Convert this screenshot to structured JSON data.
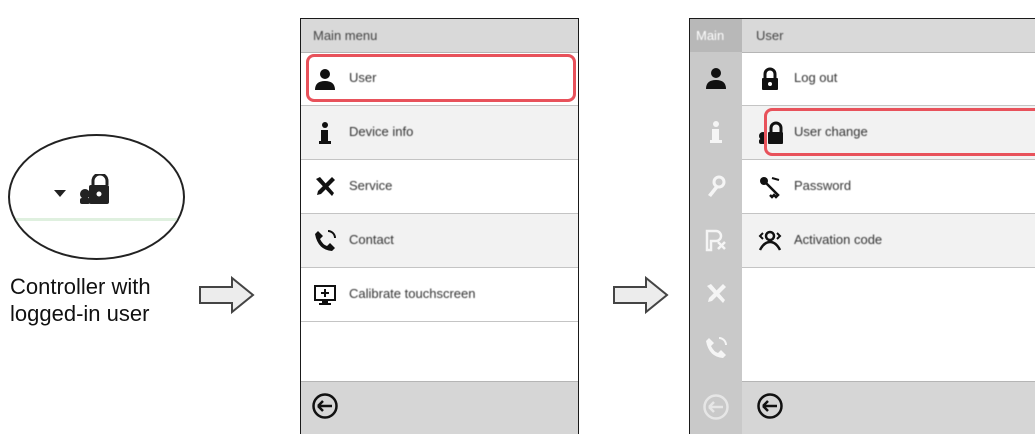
{
  "caption": "Controller with logged-in user",
  "zoom": {
    "icons": [
      "dropdown-arrow-icon",
      "user-lock-icon"
    ]
  },
  "main_menu": {
    "title": "Main menu",
    "items": [
      {
        "label": "User",
        "icon": "user-icon"
      },
      {
        "label": "Device info",
        "icon": "info-icon"
      },
      {
        "label": "Service",
        "icon": "tools-icon"
      },
      {
        "label": "Contact",
        "icon": "phone-icon"
      },
      {
        "label": "Calibrate touchscreen",
        "icon": "monitor-calibrate-icon"
      }
    ],
    "footer_icon": "back-icon"
  },
  "user_menu": {
    "side_title": "Main",
    "title": "User",
    "items": [
      {
        "label": "Log out",
        "icon": "lock-icon"
      },
      {
        "label": "User change",
        "icon": "user-change-icon"
      },
      {
        "label": "Password",
        "icon": "password-icon"
      },
      {
        "label": "Activation code",
        "icon": "activation-code-icon"
      }
    ],
    "side_icons": [
      "user-icon",
      "info-icon",
      "settings-icon",
      "program-icon",
      "tools-icon",
      "phone-icon",
      "back-icon"
    ],
    "footer_icon": "back-icon"
  },
  "colors": {
    "highlight": "#e8525b",
    "header": "#d9d9d9",
    "side_column": "#c9c9c9"
  }
}
